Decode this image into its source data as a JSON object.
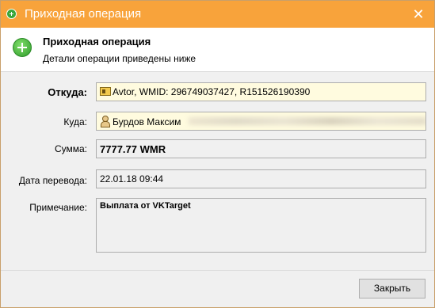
{
  "window": {
    "title": "Приходная операция",
    "close_glyph": "✕",
    "accent": "#f8a33b"
  },
  "header": {
    "title": "Приходная операция",
    "subtitle": "Детали операции приведены ниже"
  },
  "form": {
    "from": {
      "label": "Откуда:",
      "value": "Avtor, WMID: 296749037427, R151526190390",
      "icon": "wmid-card-icon"
    },
    "to": {
      "label": "Куда:",
      "value": "Бурдов Максим",
      "icon": "person-icon"
    },
    "amount": {
      "label": "Сумма:",
      "value": "7777.77 WMR"
    },
    "date": {
      "label": "Дата перевода:",
      "value": "22.01.18 09:44"
    },
    "note": {
      "label": "Примечание:",
      "value": "Выплата от VKTarget"
    }
  },
  "footer": {
    "close_label": "Закрыть"
  }
}
